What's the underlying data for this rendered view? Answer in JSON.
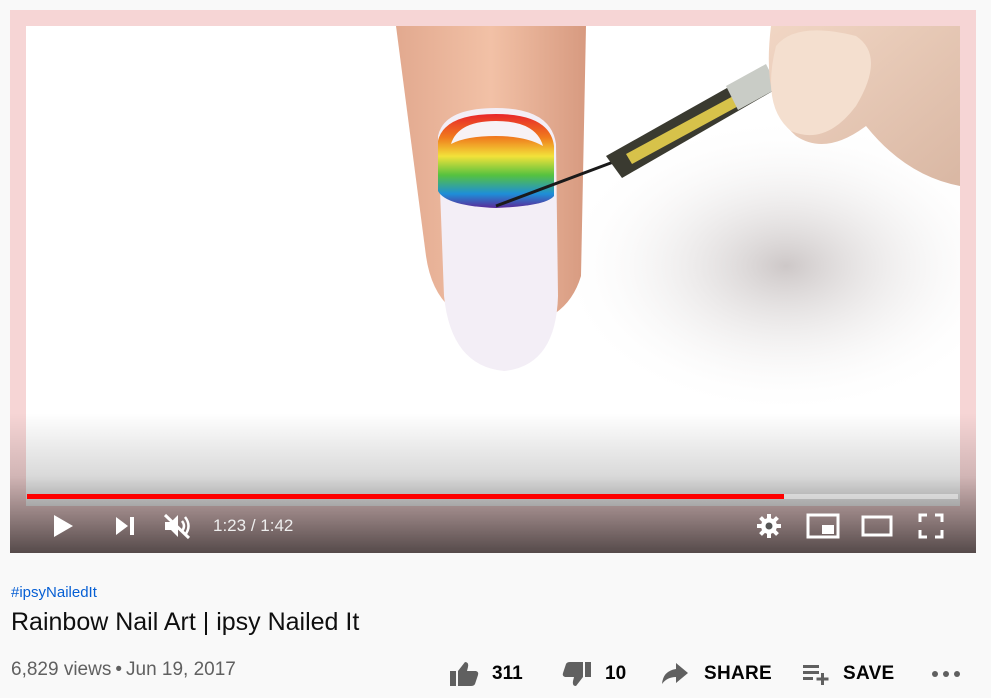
{
  "player": {
    "time": {
      "current": "1:23",
      "separator": " / ",
      "duration": "1:42"
    },
    "progress_fraction": 0.813,
    "colors": {
      "progress": "#ff0000",
      "frame_border": "#f6d5d5"
    },
    "controls": [
      "play-icon",
      "next-icon",
      "mute-icon",
      "settings-icon",
      "miniplayer-icon",
      "theater-icon",
      "fullscreen-icon"
    ]
  },
  "video": {
    "hashtag": "#ipsyNailedIt",
    "title": "Rainbow Nail Art | ipsy Nailed It",
    "views": "6,829 views",
    "dot": "•",
    "date": "Jun 19, 2017"
  },
  "actions": {
    "likes": "311",
    "dislikes": "10",
    "share": "SHARE",
    "save": "SAVE"
  }
}
